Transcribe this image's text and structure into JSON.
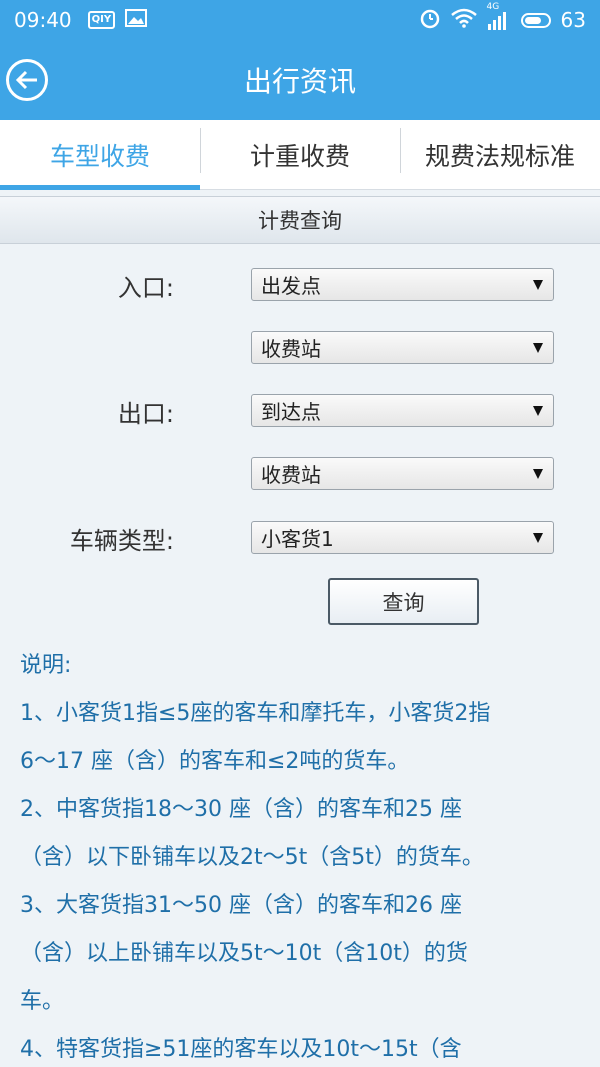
{
  "status_bar": {
    "time": "09:40",
    "qiy_badge": "QIY",
    "network": "4G",
    "battery": "63",
    "icons": [
      "qiy-icon",
      "image-icon",
      "alarm-icon",
      "wifi-icon",
      "signal-icon",
      "battery-icon"
    ]
  },
  "app_bar": {
    "back_icon": "back-arrow-icon",
    "title": "出行资讯"
  },
  "tabs": [
    {
      "label": "车型收费",
      "active": true
    },
    {
      "label": "计重收费",
      "active": false
    },
    {
      "label": "规费法规标准",
      "active": false
    }
  ],
  "section": {
    "title": "计费查询"
  },
  "form": {
    "entry_label": "入口:",
    "entry_point": "出发点",
    "entry_station": "收费站",
    "exit_label": "出口:",
    "exit_point": "到达点",
    "exit_station": "收费站",
    "vehicle_label": "车辆类型:",
    "vehicle_type": "小客货1",
    "query_button": "查询"
  },
  "notes": {
    "heading": "说明:",
    "lines": [
      "1、小客货1指≤5座的客车和摩托车，小客货2指",
      "6～17 座（含）的客车和≤2吨的货车。",
      "2、中客货指18～30 座（含）的客车和25 座",
      "（含）以下卧铺车以及2t～5t（含5t）的货车。",
      "3、大客货指31～50 座（含）的客车和26 座",
      "（含）以上卧铺车以及5t～10t（含10t）的货",
      "车。",
      "4、特客货指≥51座的客车以及10t～15t（含"
    ]
  },
  "colors": {
    "primary": "#3ea5e6",
    "note_text": "#1f6fa8",
    "background": "#eef3f7"
  }
}
